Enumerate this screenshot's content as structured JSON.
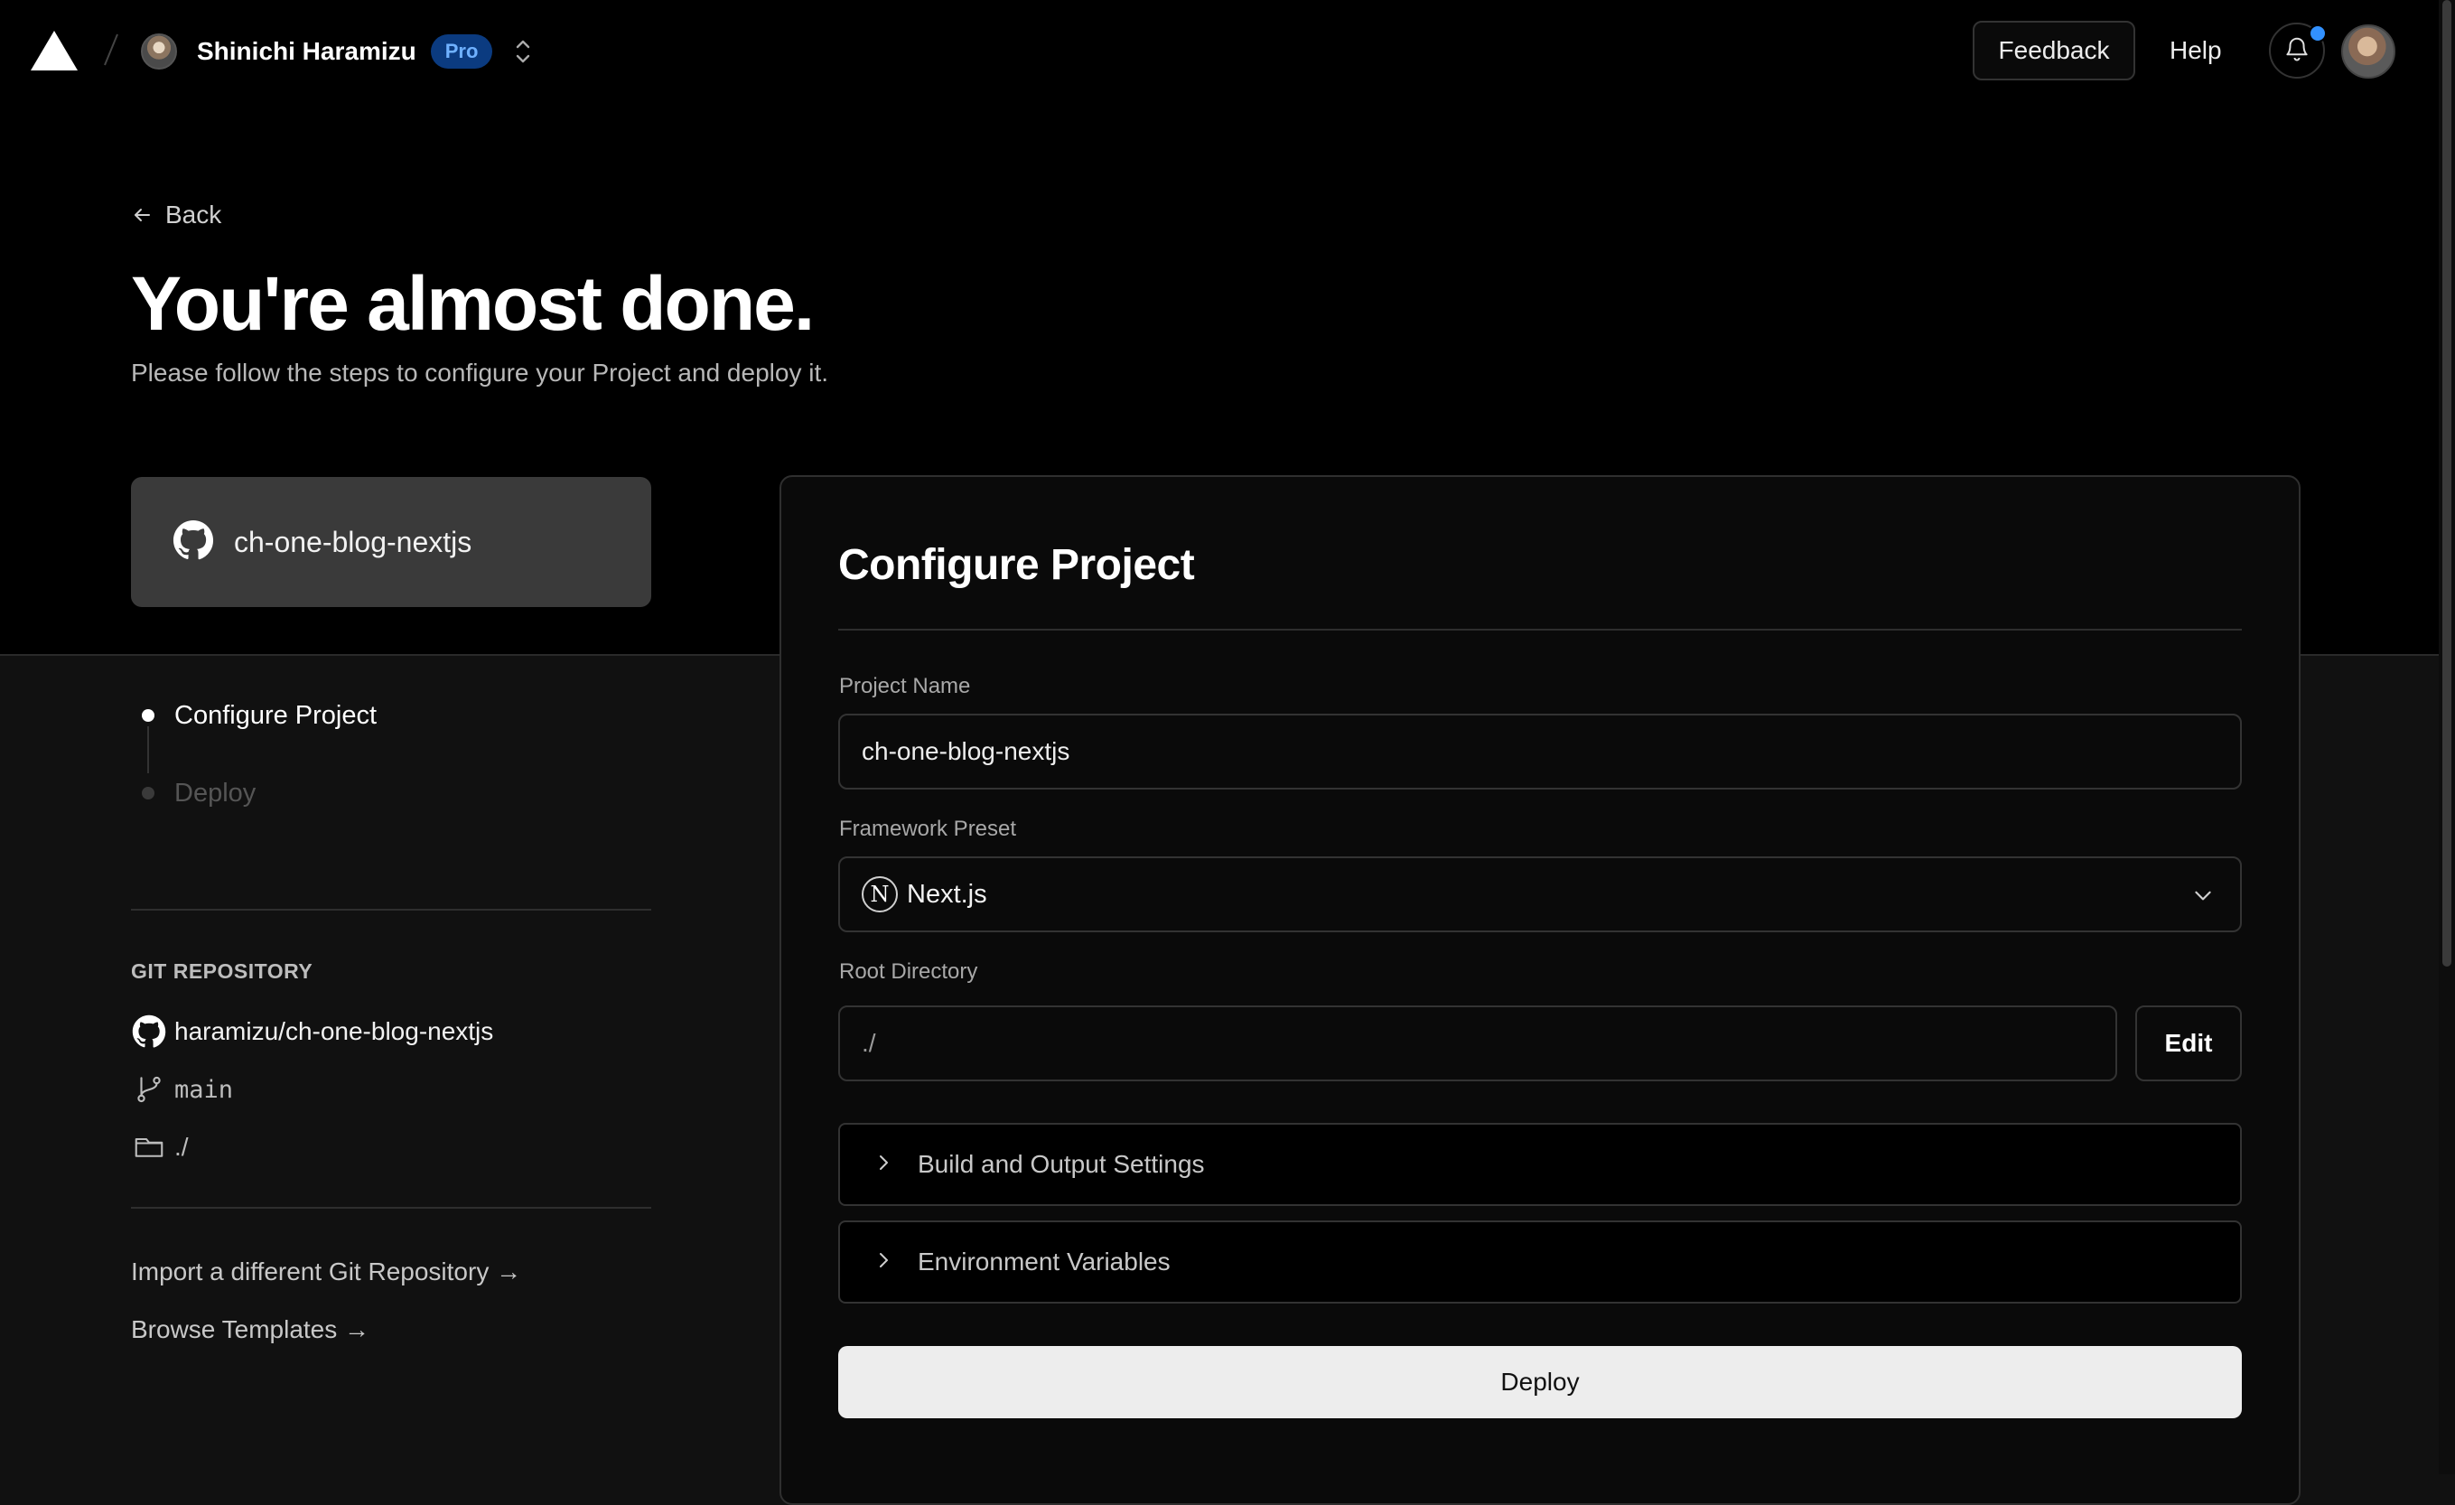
{
  "nav": {
    "team_name": "Shinichi Haramizu",
    "plan_badge": "Pro",
    "feedback_label": "Feedback",
    "help_label": "Help"
  },
  "hero": {
    "back_label": "Back",
    "title": "You're almost done.",
    "subtitle": "Please follow the steps to configure your Project and deploy it."
  },
  "repo_card": {
    "name": "ch-one-blog-nextjs"
  },
  "steps": [
    {
      "label": "Configure Project",
      "state": "active"
    },
    {
      "label": "Deploy",
      "state": "pending"
    }
  ],
  "git": {
    "heading": "GIT REPOSITORY",
    "repo": "haramizu/ch-one-blog-nextjs",
    "branch": "main",
    "directory": "./"
  },
  "links": {
    "import_different": "Import a different Git Repository →",
    "browse_templates": "Browse Templates →"
  },
  "configure": {
    "title": "Configure Project",
    "project_name_label": "Project Name",
    "project_name_value": "ch-one-blog-nextjs",
    "framework_label": "Framework Preset",
    "framework_value": "Next.js",
    "root_dir_label": "Root Directory",
    "root_dir_value": "./",
    "edit_label": "Edit",
    "build_settings_label": "Build and Output Settings",
    "env_vars_label": "Environment Variables",
    "deploy_label": "Deploy"
  },
  "colors": {
    "background_top": "#000000",
    "background_bottom": "#111111",
    "pro_badge_bg": "#0b3b80",
    "pro_badge_text": "#6fb1ff",
    "notification_dot": "#3291ff",
    "deploy_button_bg": "#ededed"
  },
  "icons": {
    "logo": "vercel-triangle-icon",
    "repo": "github-icon",
    "branch": "git-branch-icon",
    "folder": "folder-icon",
    "bell": "bell-icon",
    "framework": "nextjs-icon"
  }
}
